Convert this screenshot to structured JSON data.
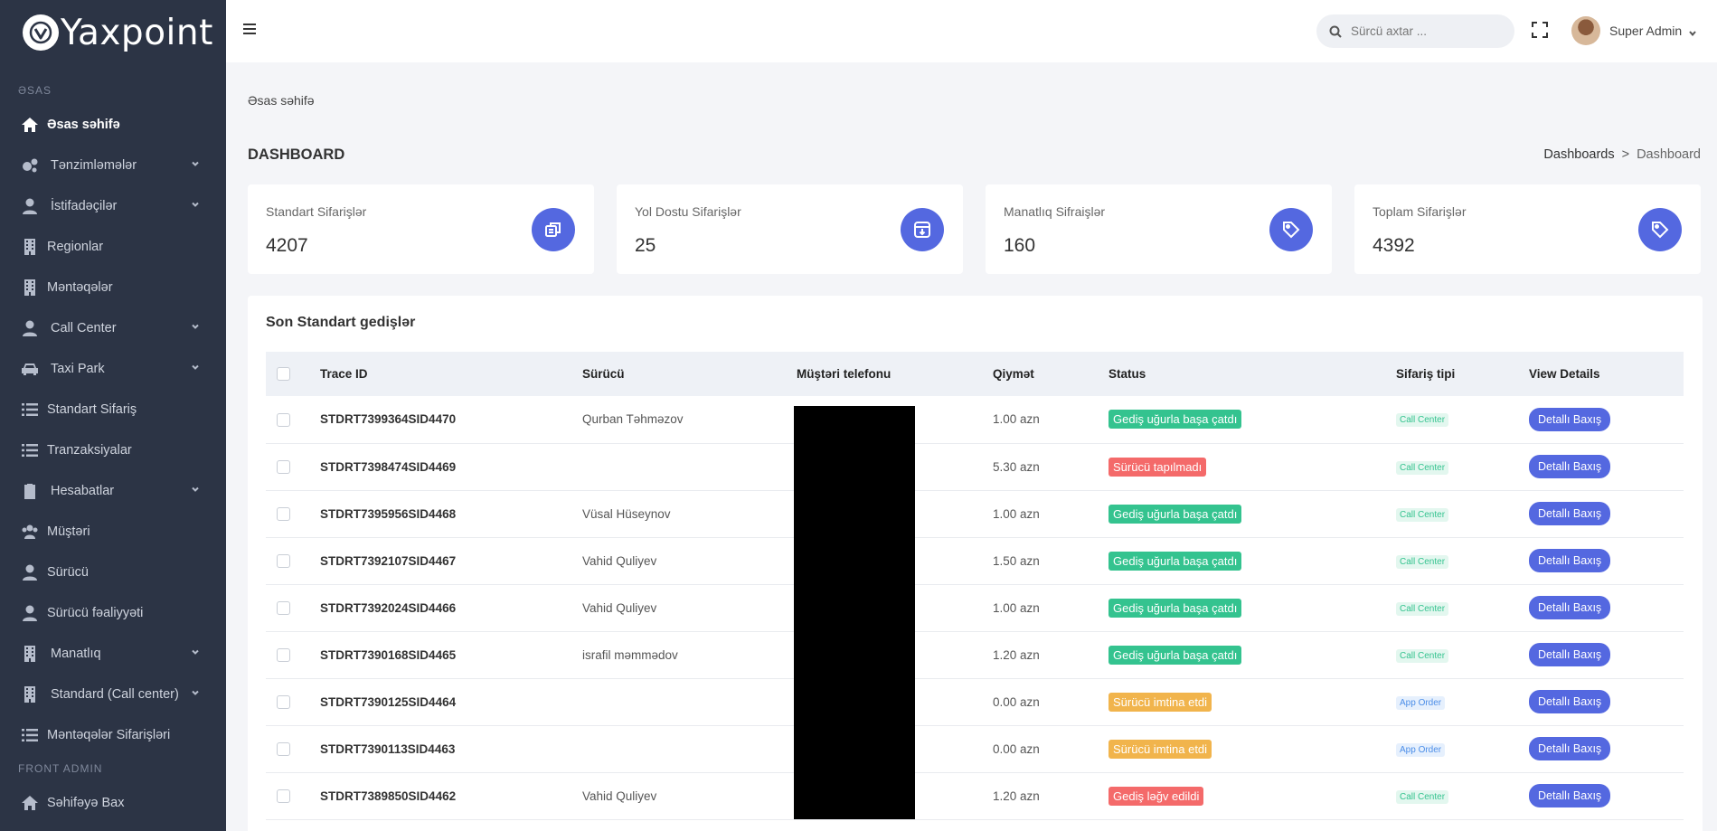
{
  "logo": {
    "text": "Yaxpoint"
  },
  "sidebar": {
    "section_main": "ƏSAS",
    "items": [
      {
        "label": "Əsas səhifə",
        "icon": "home-icon",
        "active": true,
        "chevron": false
      },
      {
        "label": "Tənzimləmələr",
        "icon": "gears-icon",
        "chevron": true
      },
      {
        "label": "İstifadəçilər",
        "icon": "user-icon",
        "chevron": true
      },
      {
        "label": "Regionlar",
        "icon": "building-icon",
        "chevron": false
      },
      {
        "label": "Məntəqələr",
        "icon": "building-icon",
        "chevron": false
      },
      {
        "label": "Call Center",
        "icon": "user-icon",
        "chevron": true
      },
      {
        "label": "Taxi Park",
        "icon": "car-icon",
        "chevron": true
      },
      {
        "label": "Standart Sifariş",
        "icon": "list-icon",
        "chevron": false
      },
      {
        "label": "Tranzaksiyalar",
        "icon": "list-icon",
        "chevron": false
      },
      {
        "label": "Hesabatlar",
        "icon": "clipboard-icon",
        "chevron": true
      },
      {
        "label": "Müştəri",
        "icon": "users-icon",
        "chevron": false
      },
      {
        "label": "Sürücü",
        "icon": "user-icon",
        "chevron": false
      },
      {
        "label": "Sürücü fəaliyyəti",
        "icon": "user-icon",
        "chevron": false
      },
      {
        "label": "Manatlıq",
        "icon": "building-icon",
        "chevron": true
      },
      {
        "label": "Standard (Call center)",
        "icon": "building-icon",
        "chevron": true
      },
      {
        "label": "Məntəqələr Sifarişləri",
        "icon": "list-icon",
        "chevron": false
      }
    ],
    "section_front": "FRONT ADMIN",
    "front_items": [
      {
        "label": "Səhifəyə Bax",
        "icon": "home-icon"
      }
    ]
  },
  "header": {
    "search_placeholder": "Sürcü axtar ...",
    "user_name": "Super Admin"
  },
  "page": {
    "crumb_top": "Əsas səhifə",
    "title": "DASHBOARD",
    "breadcrumb": {
      "parent": "Dashboards",
      "separator": ">",
      "current": "Dashboard"
    }
  },
  "cards": [
    {
      "label": "Standart Sifarişlər",
      "value": "4207",
      "icon": "copy-icon"
    },
    {
      "label": "Yol Dostu Sifarişlər",
      "value": "25",
      "icon": "archive-icon"
    },
    {
      "label": "Manatlıq Sifraişlər",
      "value": "160",
      "icon": "tag-icon"
    },
    {
      "label": "Toplam Sifarişlər",
      "value": "4392",
      "icon": "tag-icon"
    }
  ],
  "table": {
    "title": "Son Standart gedişlər",
    "columns": [
      "Trace ID",
      "Sürücü",
      "Müştəri telefonu",
      "Qiymət",
      "Status",
      "Sifariş tipi",
      "View Details"
    ],
    "button_label": "Detallı Baxış",
    "rows": [
      {
        "trace_id": "STDRT7399364SID4470",
        "driver": "Qurban Təhməzov",
        "phone": "",
        "price": "1.00 azn",
        "status": "Gediş uğurla başa çatdı",
        "status_type": "success",
        "order_type": "Call Center"
      },
      {
        "trace_id": "STDRT7398474SID4469",
        "driver": "",
        "phone": "",
        "price": "5.30 azn",
        "status": "Sürücü tapılmadı",
        "status_type": "danger",
        "order_type": "Call Center"
      },
      {
        "trace_id": "STDRT7395956SID4468",
        "driver": "Vüsal Hüseynov",
        "phone": "",
        "price": "1.00 azn",
        "status": "Gediş uğurla başa çatdı",
        "status_type": "success",
        "order_type": "Call Center"
      },
      {
        "trace_id": "STDRT7392107SID4467",
        "driver": "Vahid Quliyev",
        "phone": "",
        "price": "1.50 azn",
        "status": "Gediş uğurla başa çatdı",
        "status_type": "success",
        "order_type": "Call Center"
      },
      {
        "trace_id": "STDRT7392024SID4466",
        "driver": "Vahid Quliyev",
        "phone": "",
        "price": "1.00 azn",
        "status": "Gediş uğurla başa çatdı",
        "status_type": "success",
        "order_type": "Call Center"
      },
      {
        "trace_id": "STDRT7390168SID4465",
        "driver": "israfil məmmədov",
        "phone": "",
        "price": "1.20 azn",
        "status": "Gediş uğurla başa çatdı",
        "status_type": "success",
        "order_type": "Call Center"
      },
      {
        "trace_id": "STDRT7390125SID4464",
        "driver": "",
        "phone": "",
        "price": "0.00 azn",
        "status": "Sürücü imtina etdi",
        "status_type": "warning",
        "order_type": "App Order"
      },
      {
        "trace_id": "STDRT7390113SID4463",
        "driver": "",
        "phone": "",
        "price": "0.00 azn",
        "status": "Sürücü imtina etdi",
        "status_type": "warning",
        "order_type": "App Order"
      },
      {
        "trace_id": "STDRT7389850SID4462",
        "driver": "Vahid Quliyev",
        "phone": "",
        "price": "1.20 azn",
        "status": "Gediş ləğv edildi",
        "status_type": "danger",
        "order_type": "Call Center"
      }
    ]
  },
  "colors": {
    "sidebar_bg": "#2c3445",
    "accent": "#5468e0",
    "success": "#34c38f",
    "danger": "#f46a6a",
    "warning": "#f1b44c"
  }
}
